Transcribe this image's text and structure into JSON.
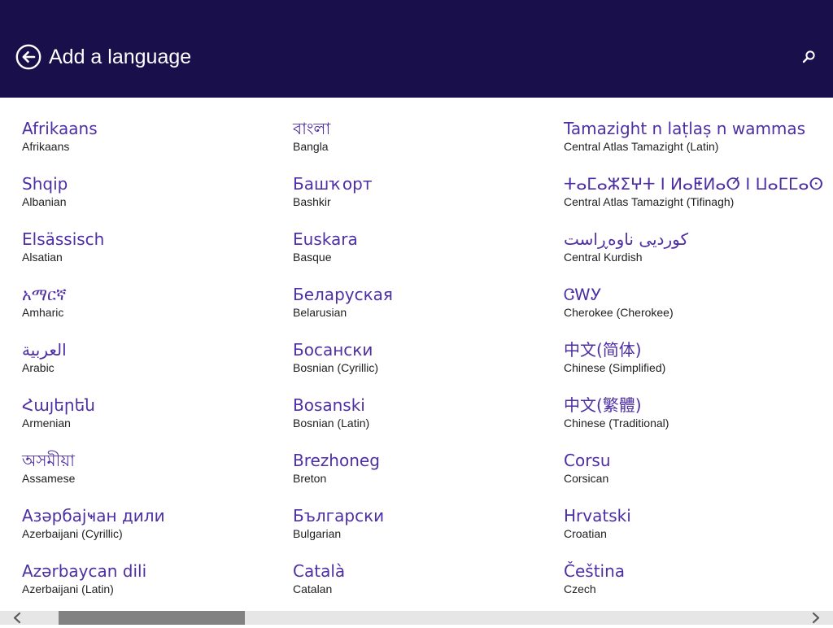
{
  "header": {
    "title": "Add a language",
    "back_icon": "back-arrow-circle-icon",
    "search_icon": "search-icon",
    "background_color": "#180f4b"
  },
  "accent_color": "#4e2fa3",
  "languages": {
    "column1": [
      {
        "native": "Afrikaans",
        "english": "Afrikaans"
      },
      {
        "native": "Shqip",
        "english": "Albanian"
      },
      {
        "native": "Elsässisch",
        "english": "Alsatian"
      },
      {
        "native": "አማርኛ",
        "english": "Amharic"
      },
      {
        "native": "العربية",
        "english": "Arabic"
      },
      {
        "native": "Հայերեն",
        "english": "Armenian"
      },
      {
        "native": "অসমীয়া",
        "english": "Assamese"
      },
      {
        "native": "Азәрбајҹан дили",
        "english": "Azerbaijani (Cyrillic)"
      },
      {
        "native": "Azərbaycan dili",
        "english": "Azerbaijani (Latin)"
      }
    ],
    "column2": [
      {
        "native": "বাংলা",
        "english": "Bangla"
      },
      {
        "native": "Башҡорт",
        "english": "Bashkir"
      },
      {
        "native": "Euskara",
        "english": "Basque"
      },
      {
        "native": "Беларуская",
        "english": "Belarusian"
      },
      {
        "native": "Босански",
        "english": "Bosnian (Cyrillic)"
      },
      {
        "native": "Bosanski",
        "english": "Bosnian (Latin)"
      },
      {
        "native": "Brezhoneg",
        "english": "Breton"
      },
      {
        "native": "Български",
        "english": "Bulgarian"
      },
      {
        "native": "Català",
        "english": "Catalan"
      }
    ],
    "column3": [
      {
        "native": "Tamazight n laṭlaṣ n wammas",
        "english": "Central Atlas Tamazight (Latin)"
      },
      {
        "native": "ⵜⴰⵎⴰⵣⵉⵖⵜ ⵏ ⵍⴰⵟⵍⴰⵚ ⵏ ⵡⴰⵎⵎⴰⵙ",
        "english": "Central Atlas Tamazight (Tifinagh)"
      },
      {
        "native": "کوردیی ناوەڕاست",
        "english": "Central Kurdish"
      },
      {
        "native": "ᏣᎳᎩ",
        "english": "Cherokee (Cherokee)"
      },
      {
        "native": "中文(简体)",
        "english": "Chinese (Simplified)"
      },
      {
        "native": "中文(繁體)",
        "english": "Chinese (Traditional)"
      },
      {
        "native": "Corsu",
        "english": "Corsican"
      },
      {
        "native": "Hrvatski",
        "english": "Croatian"
      },
      {
        "native": "Čeština",
        "english": "Czech"
      }
    ]
  },
  "scrollbar": {
    "left_arrow_icon": "chevron-left-icon",
    "right_arrow_icon": "chevron-right-icon"
  }
}
